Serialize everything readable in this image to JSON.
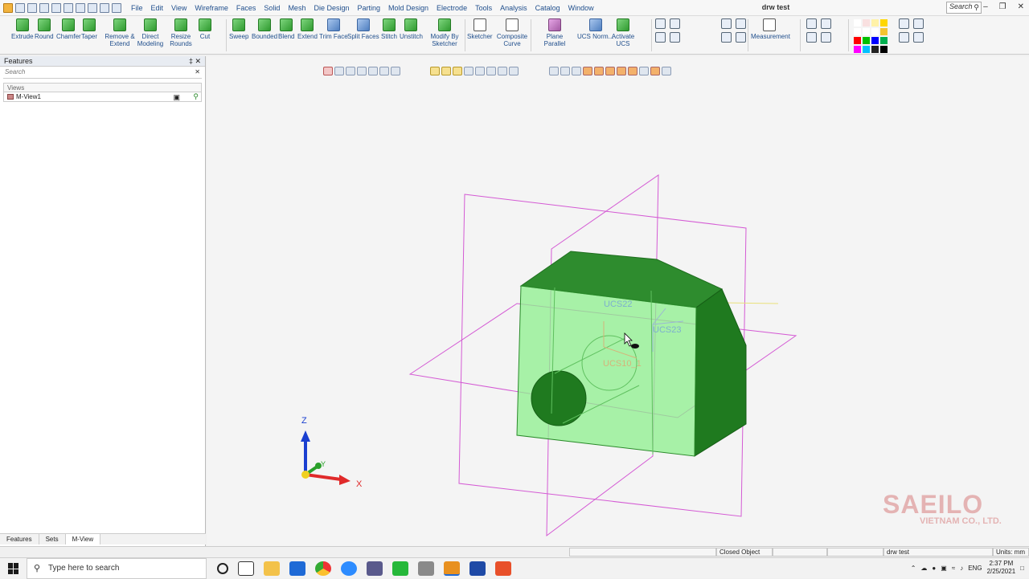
{
  "window": {
    "doc_title": "drw test",
    "search_placeholder": "Search",
    "menu": [
      "File",
      "Edit",
      "View",
      "Wireframe",
      "Faces",
      "Solid",
      "Mesh",
      "Die Design",
      "Parting",
      "Mold Design",
      "Electrode",
      "Tools",
      "Analysis",
      "Catalog",
      "Window"
    ]
  },
  "ribbon": {
    "tools": [
      {
        "label": "Extrude",
        "color": "g"
      },
      {
        "label": "Round",
        "color": "g"
      },
      {
        "label": "Chamfer",
        "color": "g"
      },
      {
        "label": "Taper",
        "color": "g"
      },
      {
        "label": "Remove & Extend",
        "color": "g"
      },
      {
        "label": "Direct Modeling",
        "color": "g"
      },
      {
        "label": "Resize Rounds",
        "color": "g"
      },
      {
        "label": "Cut",
        "color": "g"
      },
      {
        "label": "Sweep",
        "color": "g"
      },
      {
        "label": "Bounded",
        "color": "g"
      },
      {
        "label": "Blend",
        "color": "g"
      },
      {
        "label": "Extend",
        "color": "g"
      },
      {
        "label": "Trim Face",
        "color": "b"
      },
      {
        "label": "Split Faces",
        "color": "b"
      },
      {
        "label": "Stitch",
        "color": "g"
      },
      {
        "label": "Unstitch",
        "color": "g"
      },
      {
        "label": "Modify By Sketcher",
        "color": "g"
      },
      {
        "label": "Sketcher",
        "color": "k"
      },
      {
        "label": "Composite Curve",
        "color": "k"
      },
      {
        "label": "Plane Parallel",
        "color": "p"
      },
      {
        "label": "UCS Norm...",
        "color": "b"
      },
      {
        "label": "Activate UCS",
        "color": "g"
      },
      {
        "label": "Measurement",
        "color": "k"
      }
    ],
    "palette": [
      "#ffffff",
      "#f9e0e0",
      "#fff2a8",
      "#ffd700",
      "#ffffff",
      "#ffffff",
      "#ffffff",
      "#f4c430",
      "#ff0000",
      "#00c000",
      "#0000ff",
      "#00b050",
      "#ff00ff",
      "#00c0ff",
      "#222222",
      "#000000"
    ]
  },
  "features_panel": {
    "title": "Features",
    "search_placeholder": "Search",
    "views_header": "Views",
    "view_item": "M-View1",
    "tabs": [
      "Features",
      "Sets",
      "M-View"
    ],
    "active_tab": "M-View"
  },
  "viewport": {
    "ucs_labels": [
      "UCS22",
      "UCS23",
      "UCS10_1"
    ],
    "axes": {
      "x": "X",
      "y": "Y",
      "z": "Z"
    }
  },
  "status": {
    "mode": "Closed Object",
    "doc": "drw test",
    "units": "Units: mm"
  },
  "taskbar": {
    "search_placeholder": "Type here to search",
    "language": "ENG",
    "time": "2:37 PM",
    "date": "2/25/2021"
  },
  "watermark": {
    "name": "SAEILO",
    "sub": "VIETNAM CO., LTD."
  }
}
